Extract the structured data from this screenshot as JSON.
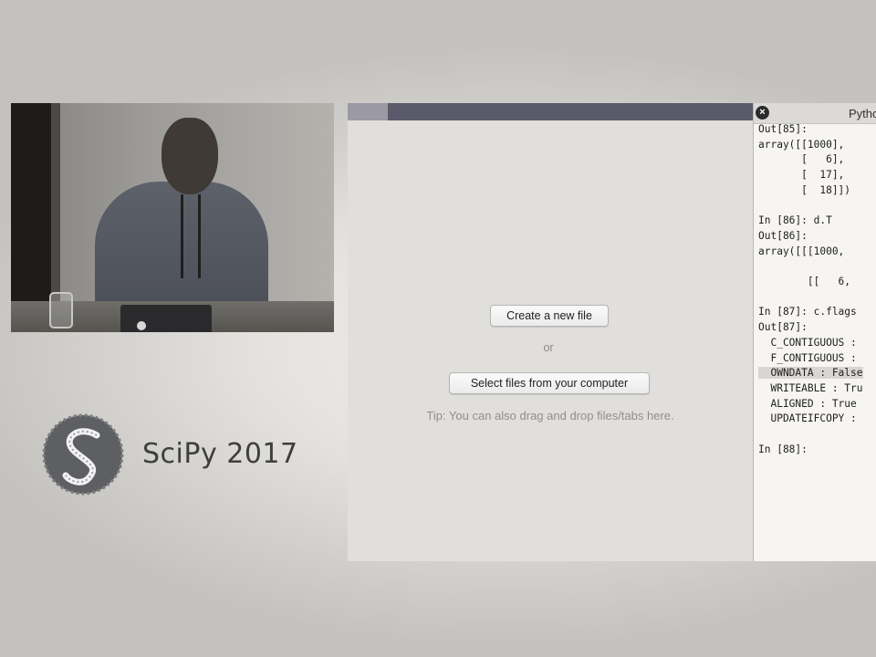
{
  "brand": {
    "logo_letter": "S",
    "name": "SciPy 2017"
  },
  "editor": {
    "create_button": "Create a new file",
    "or_text": "or",
    "select_button": "Select files from your computer",
    "tip": "Tip: You can also drag and drop files/tabs here."
  },
  "console": {
    "close_icon": "close-icon",
    "title": "Pytho",
    "lines": [
      "Out[85]:",
      "array([[1000],",
      "       [   6],",
      "       [  17],",
      "       [  18]])",
      "",
      "In [86]: d.T",
      "Out[86]:",
      "array([[[1000,",
      "",
      "        [[   6,",
      "",
      "In [87]: c.flags",
      "Out[87]:",
      "  C_CONTIGUOUS :",
      "  F_CONTIGUOUS :",
      "  OWNDATA : False",
      "  WRITEABLE : Tru",
      "  ALIGNED : True",
      "  UPDATEIFCOPY :",
      "",
      "In [88]:"
    ]
  }
}
